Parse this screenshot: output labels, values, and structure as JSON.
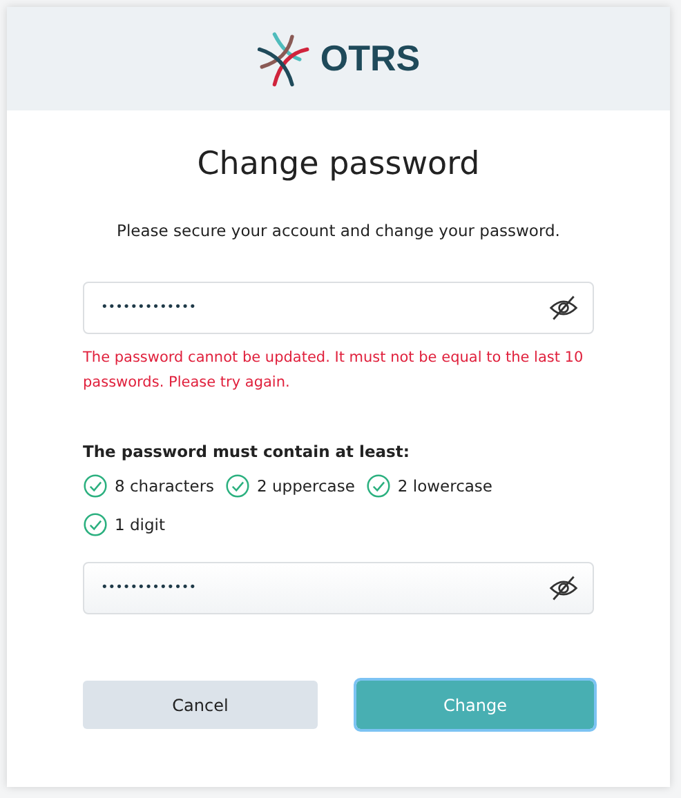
{
  "header": {
    "logo_text": "OTRS"
  },
  "title": "Change password",
  "subtitle": "Please secure your account and change your password.",
  "password_field": {
    "value": "•••••••••••••",
    "revealed": false
  },
  "error": "The password cannot be updated. It must not be equal to the last 10 passwords. Please try again.",
  "requirements_heading": "The password must contain at least:",
  "requirements": [
    {
      "label": "8 characters",
      "met": true
    },
    {
      "label": "2 uppercase",
      "met": true
    },
    {
      "label": "2 lowercase",
      "met": true
    },
    {
      "label": "1 digit",
      "met": true
    }
  ],
  "confirm_field": {
    "value": "•••••••••••••",
    "revealed": false
  },
  "buttons": [
    {
      "label": "Cancel",
      "kind": "secondary",
      "focused": false
    },
    {
      "label": "Change",
      "kind": "primary",
      "focused": true
    }
  ]
}
